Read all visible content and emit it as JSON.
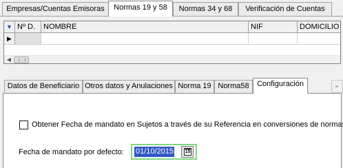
{
  "top_tabs": [
    {
      "label": "Empresas/Cuentas Emisoras",
      "active": false
    },
    {
      "label": "Normas 19 y 58",
      "active": true
    },
    {
      "label": "Normas 34 y 68",
      "active": false
    },
    {
      "label": "Verificación de Cuentas",
      "active": false
    }
  ],
  "grid": {
    "corner_icon": "filter-triangle-icon",
    "columns": [
      "Nº D.",
      "NOMBRE",
      "NIF",
      "DOMICILIO"
    ],
    "row_indicator": "current-row-arrow-icon",
    "rows": [
      [
        "",
        "",
        "",
        ""
      ]
    ]
  },
  "bottom_tabs": [
    {
      "label": "Datos de Beneficiario",
      "active": false
    },
    {
      "label": "Otros datos y Anulaciones",
      "active": false
    },
    {
      "label": "Norma 19",
      "active": false
    },
    {
      "label": "Norma58",
      "active": false
    },
    {
      "label": "Configuración",
      "active": true
    }
  ],
  "config": {
    "checkbox_label": "Obtener Fecha de mandato en Sujetos a través de su Referencia en conversiones de normas.",
    "checkbox_checked": false,
    "date_label": "Fecha de mandato por defecto:",
    "date_value": "01/10/2015",
    "calendar_button_icon": "calendar-icon",
    "calendar_day": "15",
    "focus_color": "#7ed67e",
    "selection_color": "#3158c4"
  }
}
